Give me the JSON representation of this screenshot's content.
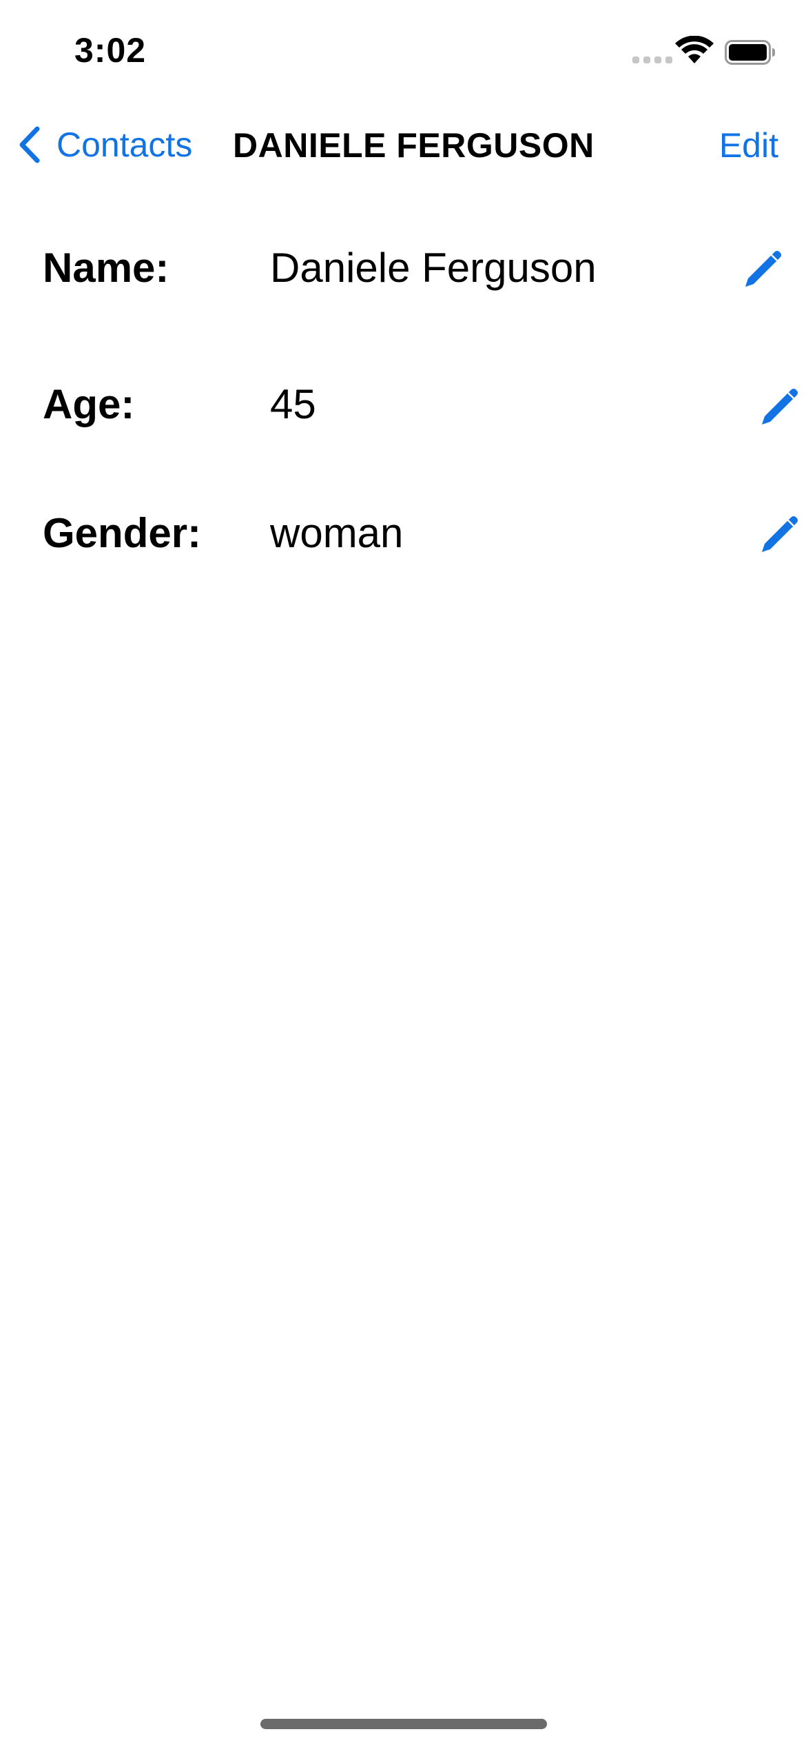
{
  "status_bar": {
    "time": "3:02",
    "icons": [
      "cell-signal-icon",
      "wifi-icon",
      "battery-icon"
    ]
  },
  "nav": {
    "back_label": "Contacts",
    "back_icon": "chevron-left-icon",
    "title": "DANIELE FERGUSON",
    "edit_label": "Edit"
  },
  "fields": [
    {
      "label": "Name:",
      "value": "Daniele Ferguson",
      "action_icon": "pencil-icon"
    },
    {
      "label": "Age:",
      "value": "45",
      "action_icon": "pencil-icon"
    },
    {
      "label": "Gender:",
      "value": "woman",
      "action_icon": "pencil-icon"
    }
  ],
  "colors": {
    "accent": "#1273e5",
    "text": "#000000",
    "background": "#ffffff",
    "inactive_signal": "#c6c6c8"
  }
}
